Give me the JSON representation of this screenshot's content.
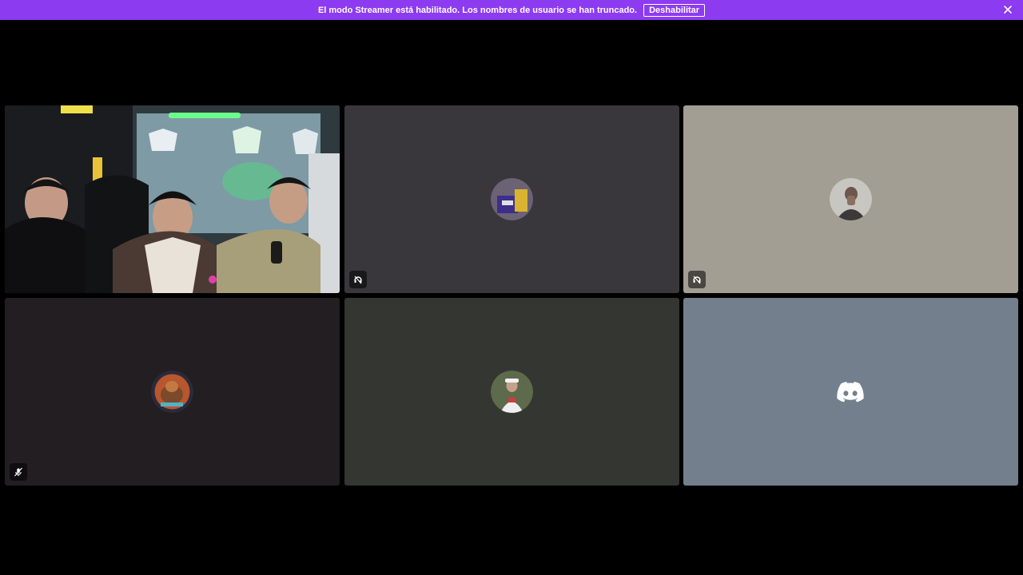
{
  "banner": {
    "message": "El modo Streamer está habilitado. Los nombres de usuario se han truncado.",
    "button_label": "Deshabilitar",
    "background": "#8c3bf1"
  },
  "tiles": [
    {
      "kind": "video",
      "speaking": true,
      "icon": "camera-video",
      "background": "#3a4a50"
    },
    {
      "kind": "avatar",
      "icon": "deafened-icon",
      "background": "#39373b"
    },
    {
      "kind": "avatar",
      "icon": "deafened-icon",
      "background": "#a29e93"
    },
    {
      "kind": "avatar",
      "icon": "muted-mic-icon",
      "background": "#221e22"
    },
    {
      "kind": "avatar",
      "icon": "none",
      "background": "#343631"
    },
    {
      "kind": "discord-logo",
      "icon": "discord-logo-icon",
      "background": "#747f8d"
    }
  ],
  "accent": {
    "speaking_ring": "#3ba55d"
  }
}
